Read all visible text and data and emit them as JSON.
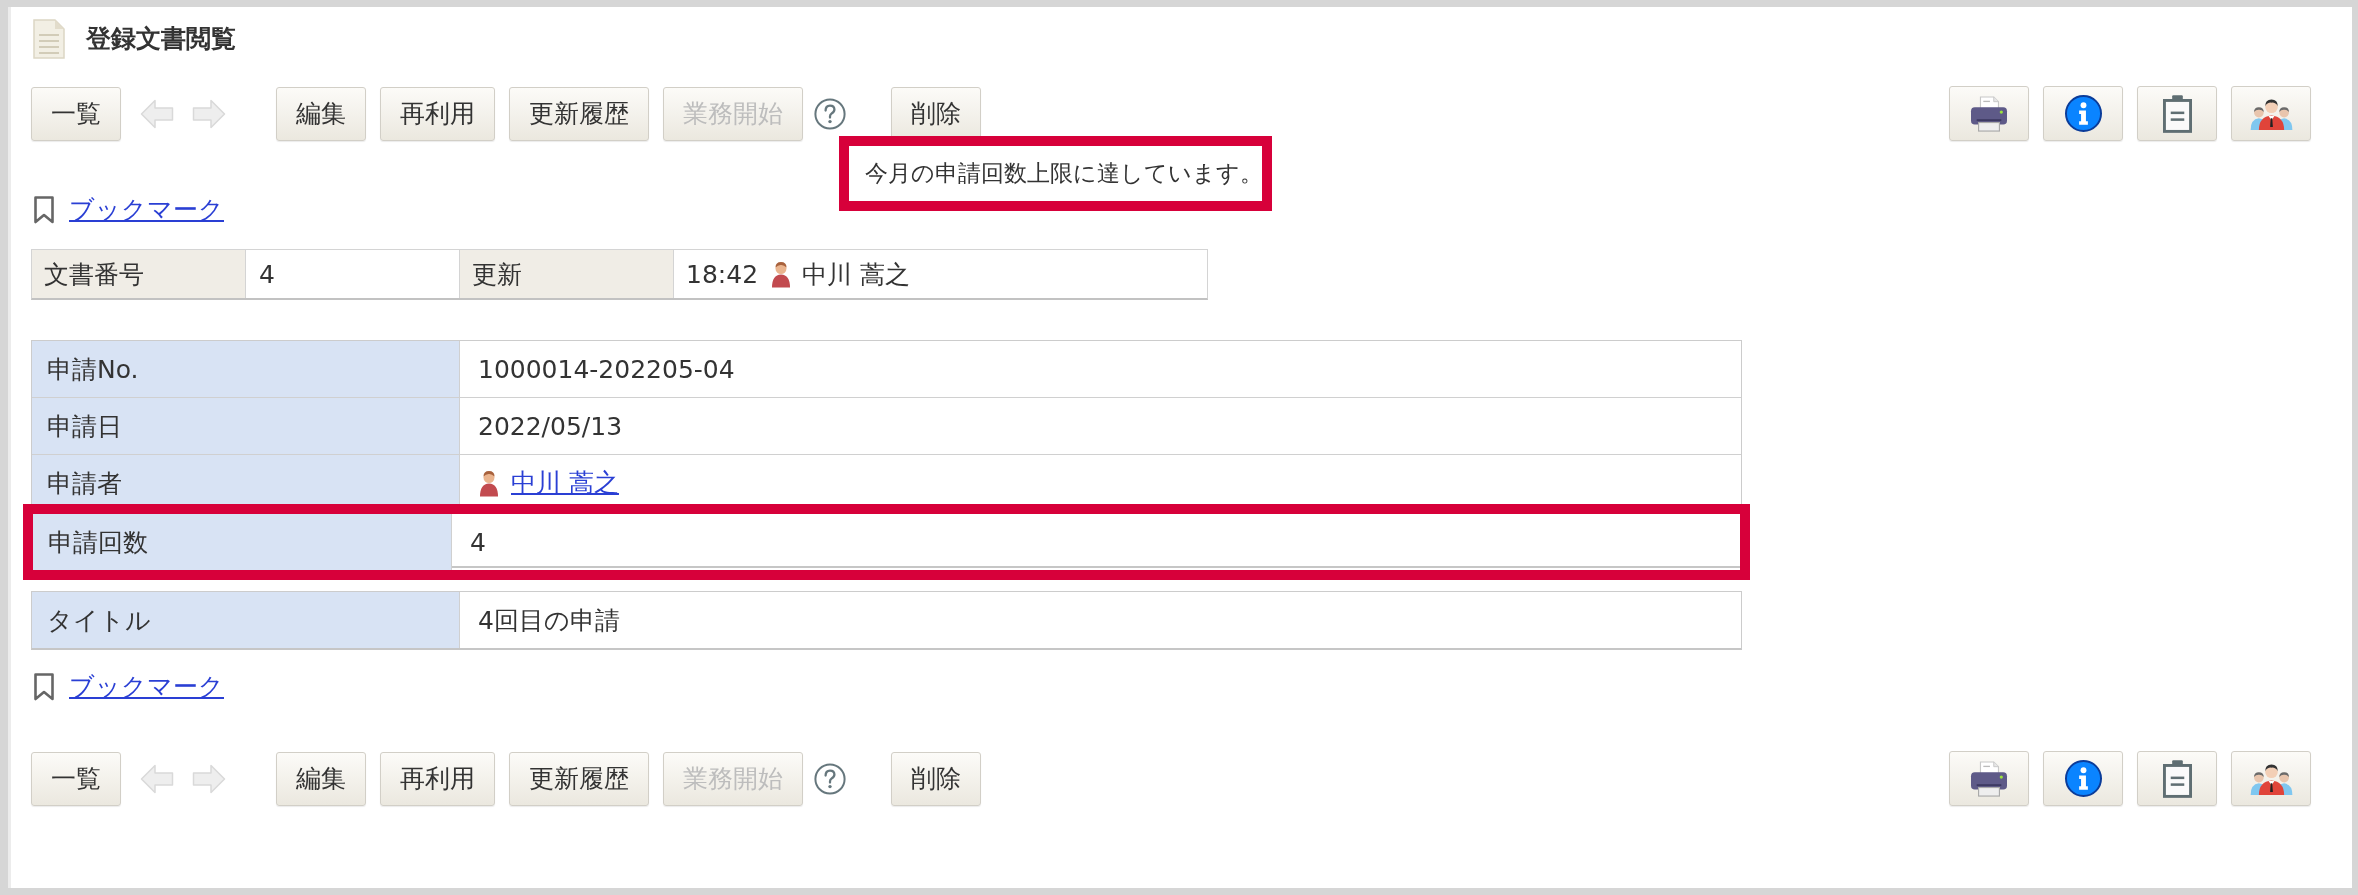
{
  "header": {
    "title": "登録文書閲覧"
  },
  "toolbar_top": {
    "items": [
      {
        "kind": "button",
        "label": "一覧",
        "disabled": false
      },
      {
        "kind": "prev",
        "disabled": true
      },
      {
        "kind": "next",
        "disabled": true
      },
      {
        "kind": "button",
        "label": "編集",
        "disabled": false
      },
      {
        "kind": "button",
        "label": "再利用",
        "disabled": false
      },
      {
        "kind": "button",
        "label": "更新履歴",
        "disabled": false
      },
      {
        "kind": "button",
        "label": "業務開始",
        "disabled": true
      },
      {
        "kind": "help",
        "disabled": false
      },
      {
        "kind": "button",
        "label": "削除",
        "disabled": false
      }
    ],
    "tooltip": {
      "text": "今月の申請回数上限に達しています。",
      "highlighted": true
    },
    "tool_buttons": [
      {
        "kind": "print"
      },
      {
        "kind": "info"
      },
      {
        "kind": "clipboard"
      },
      {
        "kind": "people"
      }
    ]
  },
  "bookmark_top": {
    "label": "ブックマーク"
  },
  "summary": {
    "cells": [
      {
        "kind": "text",
        "label": "文書番号",
        "value": "4"
      },
      {
        "kind": "updated",
        "label": "更新",
        "time": "18:42",
        "user": "中川 蒿之"
      }
    ]
  },
  "form": {
    "tables": [
      {
        "rows": [
          {
            "kind": "text",
            "label": "申請No.",
            "value": "1000014-202205-04",
            "highlighted": false
          },
          {
            "kind": "text",
            "label": "申請日",
            "value": "2022/05/13",
            "highlighted": false
          },
          {
            "kind": "user_link",
            "label": "申請者",
            "value": "中川 蒿之",
            "highlighted": false
          },
          {
            "kind": "text",
            "label": "申請回数",
            "value": "4",
            "highlighted": true
          }
        ]
      },
      {
        "rows": [
          {
            "kind": "text",
            "label": "タイトル",
            "value": "4回目の申請",
            "highlighted": false
          }
        ]
      }
    ]
  },
  "bookmark_bottom": {
    "label": "ブックマーク"
  },
  "toolbar_bottom": {
    "items": [
      {
        "kind": "button",
        "label": "一覧",
        "disabled": false
      },
      {
        "kind": "prev",
        "disabled": true
      },
      {
        "kind": "next",
        "disabled": true
      },
      {
        "kind": "button",
        "label": "編集",
        "disabled": false
      },
      {
        "kind": "button",
        "label": "再利用",
        "disabled": false
      },
      {
        "kind": "button",
        "label": "更新履歴",
        "disabled": false
      },
      {
        "kind": "button",
        "label": "業務開始",
        "disabled": true
      },
      {
        "kind": "help",
        "disabled": false
      },
      {
        "kind": "button",
        "label": "削除",
        "disabled": false
      }
    ],
    "tool_buttons": [
      {
        "kind": "print"
      },
      {
        "kind": "info"
      },
      {
        "kind": "clipboard"
      },
      {
        "kind": "people"
      }
    ]
  }
}
